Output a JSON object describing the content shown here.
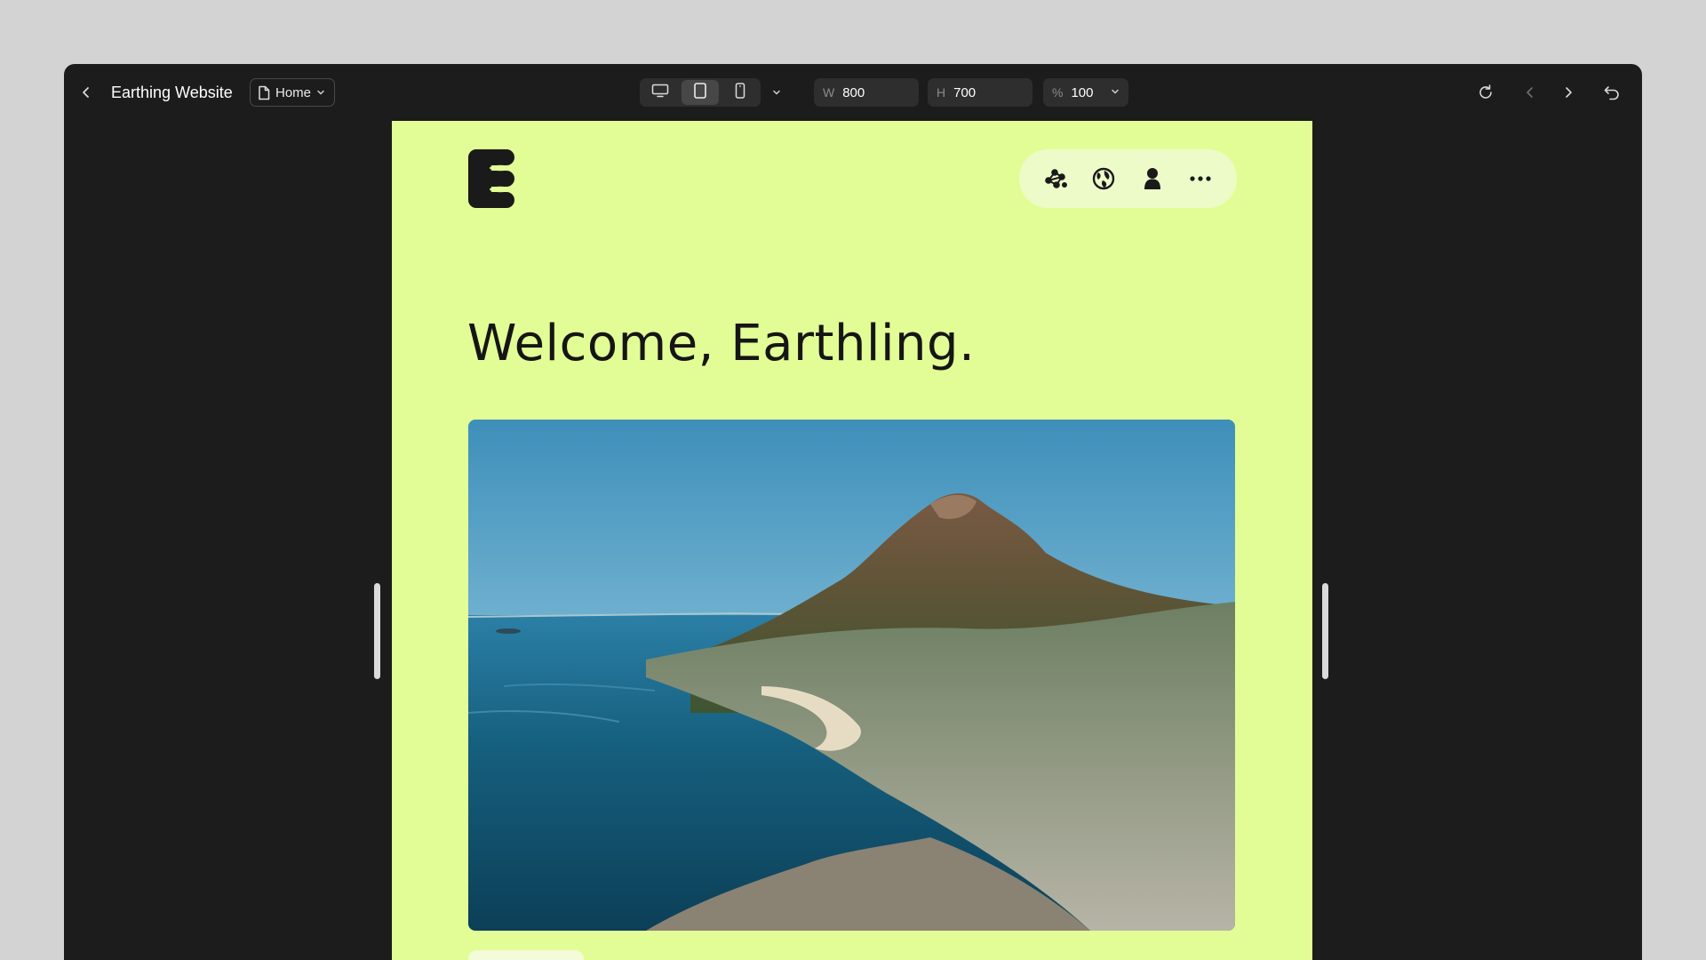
{
  "app": {
    "project_title": "Earthing Website",
    "page_selector": {
      "label": "Home",
      "icon": "page-icon"
    }
  },
  "toolbar": {
    "devices": [
      {
        "name": "desktop",
        "icon": "desktop-icon",
        "active": false
      },
      {
        "name": "tablet",
        "icon": "tablet-icon",
        "active": true
      },
      {
        "name": "mobile",
        "icon": "mobile-icon",
        "active": false
      }
    ],
    "width": {
      "label": "W",
      "value": "800"
    },
    "height": {
      "label": "H",
      "value": "700"
    },
    "zoom": {
      "label": "%",
      "value": "100"
    },
    "right_icons": [
      "refresh-icon",
      "back-icon",
      "forward-icon",
      "undo-icon"
    ]
  },
  "site": {
    "headline": "Welcome, Earthling.",
    "nav_icons": [
      "constellation-icon",
      "globe-icon",
      "user-icon",
      "more-icon"
    ],
    "hero_image": "coastal-mountain-aerial-photo"
  },
  "colors": {
    "window_bg": "#1c1c1c",
    "canvas_bg": "#e3fd96",
    "nav_pill_bg": "#edfbc9",
    "text_dark": "#151515"
  }
}
